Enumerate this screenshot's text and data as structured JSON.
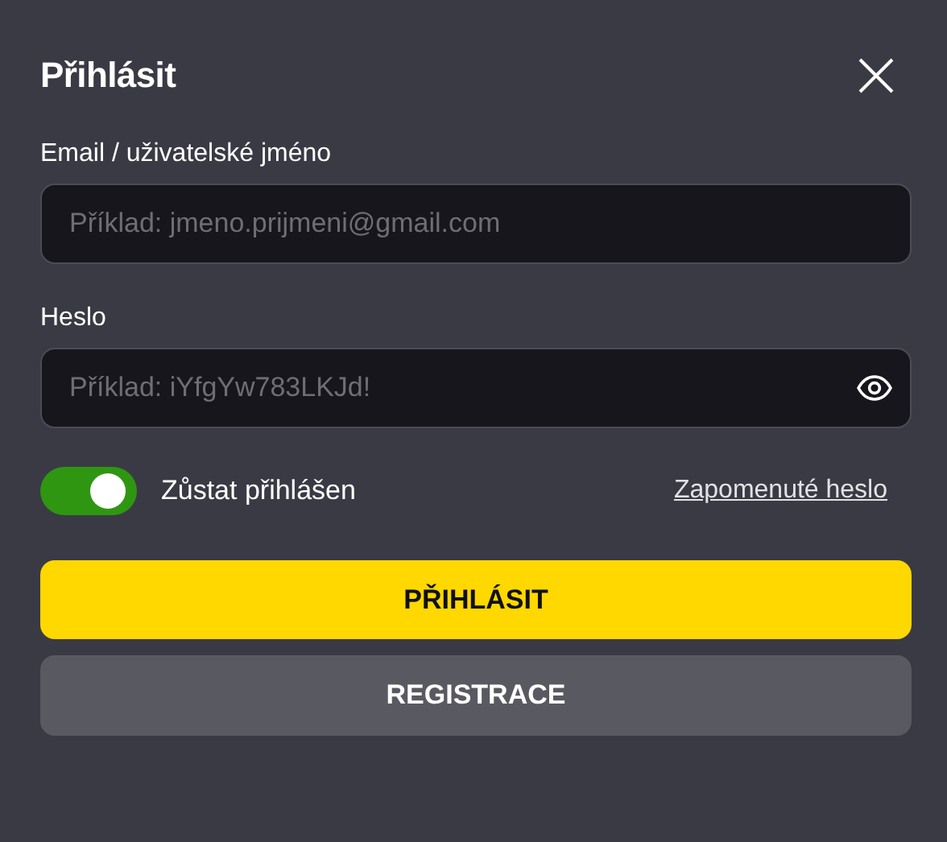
{
  "dialog": {
    "title": "Přihlásit"
  },
  "fields": [
    {
      "label": "Email / uživatelské jméno",
      "placeholder": "Příklad: jmeno.prijmeni@gmail.com",
      "kind": "text"
    },
    {
      "label": "Heslo",
      "placeholder": "Příklad: iYfgYw783LKJd!",
      "kind": "password"
    }
  ],
  "remember": {
    "label": "Zůstat přihlášen",
    "on": true
  },
  "forgot_link": "Zapomenuté heslo",
  "buttons": [
    {
      "label": "PŘIHLÁSIT",
      "kind": "primary"
    },
    {
      "label": "REGISTRACE",
      "kind": "secondary"
    }
  ]
}
